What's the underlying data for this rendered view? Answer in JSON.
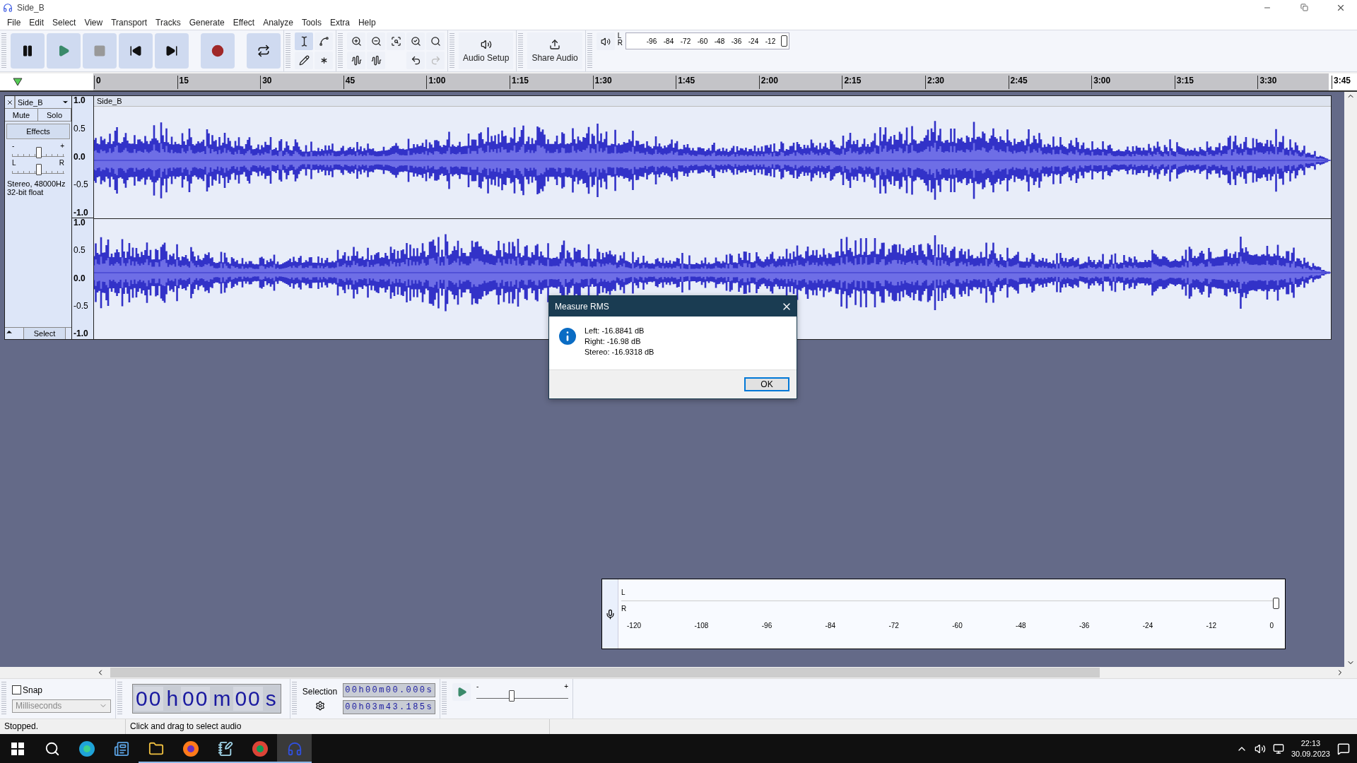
{
  "window": {
    "title": "Side_B"
  },
  "menu": [
    "File",
    "Edit",
    "Select",
    "View",
    "Transport",
    "Tracks",
    "Generate",
    "Effect",
    "Analyze",
    "Tools",
    "Extra",
    "Help"
  ],
  "transport": [
    {
      "kind": "pause"
    },
    {
      "kind": "play"
    },
    {
      "kind": "stop"
    },
    {
      "kind": "skip-start"
    },
    {
      "kind": "skip-end"
    },
    {
      "kind": "record"
    },
    {
      "kind": "loop"
    }
  ],
  "tools": [
    {
      "kind": "select",
      "selected": true
    },
    {
      "kind": "envelope",
      "selected": false
    },
    {
      "kind": "draw",
      "selected": false
    },
    {
      "kind": "multi",
      "selected": false
    }
  ],
  "edit_tools": [
    {
      "kind": "zoom-in",
      "disabled": false
    },
    {
      "kind": "zoom-out",
      "disabled": false
    },
    {
      "kind": "fit-selection",
      "disabled": false
    },
    {
      "kind": "fit-project",
      "disabled": false
    },
    {
      "kind": "zoom-toggle",
      "disabled": false
    },
    {
      "kind": "trim",
      "disabled": false
    },
    {
      "kind": "silence",
      "disabled": false
    },
    {
      "kind": "undo",
      "disabled": false
    },
    {
      "kind": "redo",
      "disabled": true
    }
  ],
  "audio_setup": {
    "label": "Audio Setup"
  },
  "share_audio": {
    "label": "Share Audio"
  },
  "playback_meter": {
    "channels": [
      "L",
      "R"
    ],
    "ticks": [
      "-96",
      "-84",
      "-72",
      "-60",
      "-48",
      "-36",
      "-24",
      "-12"
    ]
  },
  "timeline": {
    "ticks": [
      "0",
      "15",
      "30",
      "45",
      "1:00",
      "1:15",
      "1:30",
      "1:45",
      "2:00",
      "2:15",
      "2:30",
      "2:45",
      "3:00",
      "3:15",
      "3:30"
    ],
    "end_label": "3:45"
  },
  "track": {
    "name": "Side_B",
    "clip_name": "Side_B",
    "mute": "Mute",
    "solo": "Solo",
    "effects": "Effects",
    "gain": {
      "min": "-",
      "max": "+",
      "level": 0.5
    },
    "pan": {
      "left": "L",
      "right": "R",
      "level": 0.5
    },
    "info": [
      "Stereo, 48000Hz",
      "32-bit float"
    ],
    "select": "Select",
    "channels": [
      {
        "scale": [
          "1.0",
          "0.5",
          "0.0",
          "-0.5",
          "-1.0"
        ]
      },
      {
        "scale": [
          "1.0",
          "0.5",
          "0.0",
          "-0.5",
          "-1.0"
        ]
      }
    ]
  },
  "dialog": {
    "title": "Measure RMS",
    "lines": [
      "Left: -16.8841 dB",
      "Right: -16.98 dB",
      "Stereo: -16.9318 dB"
    ],
    "button": "OK"
  },
  "recording_meter": {
    "channels": [
      "L",
      "R"
    ],
    "ticks": [
      "-120",
      "-108",
      "-96",
      "-84",
      "-72",
      "-60",
      "-48",
      "-36",
      "-24",
      "-12",
      "0"
    ]
  },
  "snap": {
    "label": "Snap",
    "checked": false,
    "unit": "Milliseconds"
  },
  "time_display": {
    "segments": [
      {
        "digits": "00",
        "unit": "h"
      },
      {
        "digits": "00",
        "unit": "m"
      },
      {
        "digits": "00",
        "unit": "s"
      }
    ]
  },
  "selection": {
    "label": "Selection",
    "start": "00h00m00.000s",
    "end": "00h03m43.185s"
  },
  "play_speed": {
    "min": "-",
    "max": "+",
    "level": 0.38
  },
  "status": {
    "state": "Stopped.",
    "hint": "Click and drag to select audio"
  },
  "taskbar": {
    "apps": [
      {
        "kind": "start",
        "running": false,
        "selected": false
      },
      {
        "kind": "search",
        "running": false,
        "selected": false
      },
      {
        "kind": "edge",
        "running": false,
        "selected": false
      },
      {
        "kind": "widgets",
        "running": false,
        "selected": false
      },
      {
        "kind": "explorer",
        "running": true,
        "selected": false
      },
      {
        "kind": "firefox",
        "running": true,
        "selected": false
      },
      {
        "kind": "notepad",
        "running": true,
        "selected": false
      },
      {
        "kind": "chrome",
        "running": true,
        "selected": false
      },
      {
        "kind": "audacity",
        "running": true,
        "selected": true
      }
    ],
    "time": "22:13",
    "date": "30.09.2023"
  }
}
